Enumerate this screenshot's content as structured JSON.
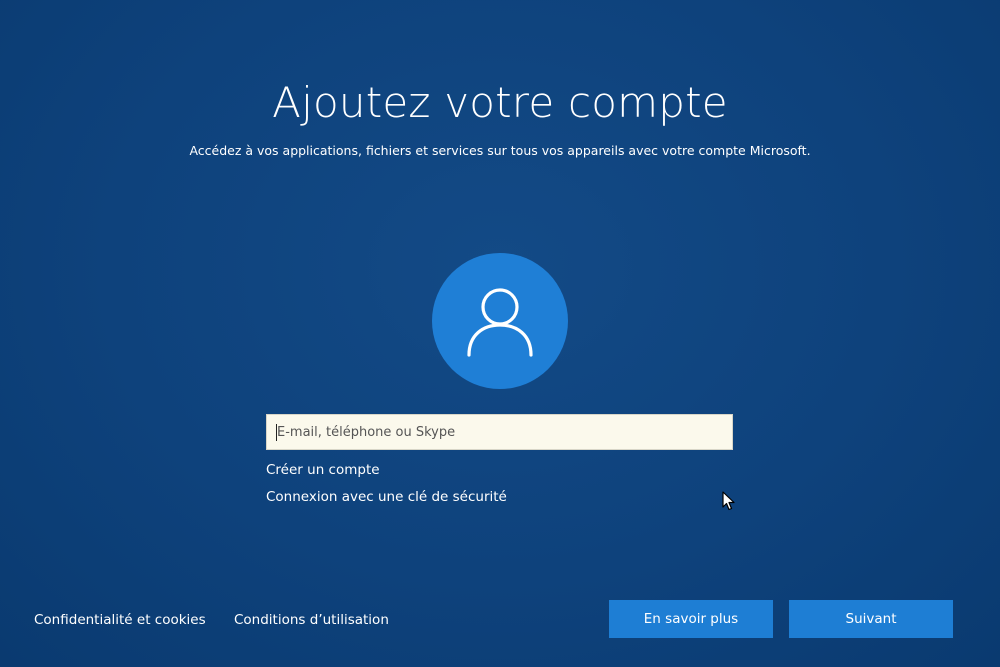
{
  "page": {
    "title": "Ajoutez votre compte",
    "subtitle": "Accédez à vos applications, fichiers et services sur tous vos appareils avec votre compte Microsoft."
  },
  "account_input": {
    "placeholder": "E-mail, téléphone ou Skype",
    "value": ""
  },
  "links": {
    "create_account": "Créer un compte",
    "security_key": "Connexion avec une clé de sécurité"
  },
  "footer": {
    "privacy": "Confidentialité et cookies",
    "terms": "Conditions d’utilisation",
    "learn_more": "En savoir plus",
    "next": "Suivant"
  },
  "icons": {
    "avatar": "user-icon",
    "cursor": "mouse-pointer-icon"
  },
  "colors": {
    "background": "#0e427c",
    "accent": "#1e7ed4",
    "input_background": "#fbf9ec"
  }
}
